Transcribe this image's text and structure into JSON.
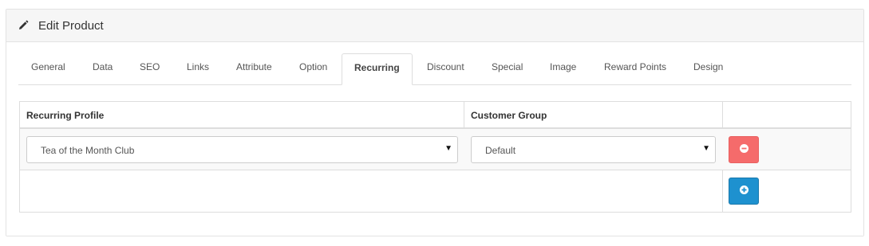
{
  "header": {
    "title": "Edit Product",
    "icon": "pencil-icon"
  },
  "tabs": [
    {
      "label": "General"
    },
    {
      "label": "Data"
    },
    {
      "label": "SEO"
    },
    {
      "label": "Links"
    },
    {
      "label": "Attribute"
    },
    {
      "label": "Option"
    },
    {
      "label": "Recurring",
      "active": true
    },
    {
      "label": "Discount"
    },
    {
      "label": "Special"
    },
    {
      "label": "Image"
    },
    {
      "label": "Reward Points"
    },
    {
      "label": "Design"
    }
  ],
  "table": {
    "headers": {
      "profile": "Recurring Profile",
      "group": "Customer Group",
      "action": ""
    },
    "rows": [
      {
        "profile": "Tea of the Month Club",
        "group": "Default"
      }
    ]
  },
  "colors": {
    "danger": "#f56b6b",
    "primary": "#1e91cf"
  }
}
